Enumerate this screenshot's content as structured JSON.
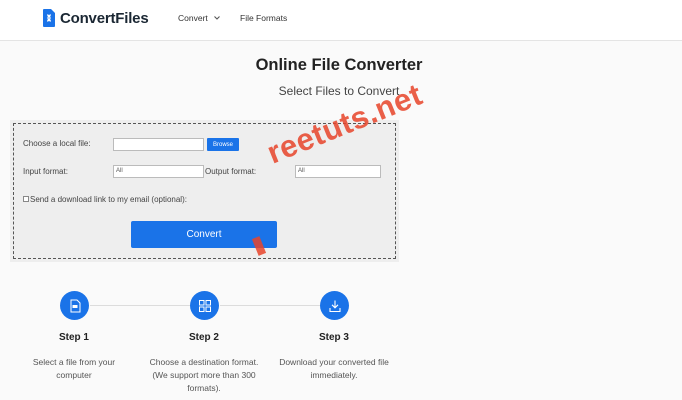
{
  "header": {
    "brand": "ConvertFiles",
    "nav": [
      {
        "label": "Convert"
      },
      {
        "label": "File Formats"
      }
    ]
  },
  "main": {
    "title": "Online File Converter",
    "subtitle": "Select Files to Convert"
  },
  "form": {
    "local_file_label": "Choose a local file:",
    "browse_label": "Browse",
    "input_format_label": "Input format:",
    "input_format_value": "All",
    "output_format_label": "Output format:",
    "output_format_value": "All",
    "email_option_label": "Send a download link to my email (optional):",
    "convert_label": "Convert"
  },
  "watermark": {
    "text_main": "reetuts.net"
  },
  "steps": [
    {
      "title": "Step 1",
      "desc_lines": [
        "Select a file from your",
        "computer"
      ],
      "icon": "file-icon"
    },
    {
      "title": "Step 2",
      "desc_lines": [
        "Choose a destination format.",
        "(We support more than 300",
        "formats)."
      ],
      "icon": "grid-icon"
    },
    {
      "title": "Step 3",
      "desc_lines": [
        "Download your converted file",
        "immediately."
      ],
      "icon": "download-icon"
    }
  ],
  "colors": {
    "accent": "#1a73e8",
    "watermark": "#e8442a"
  }
}
